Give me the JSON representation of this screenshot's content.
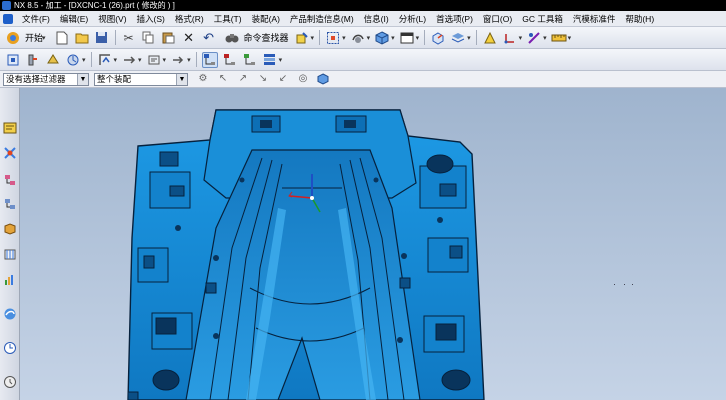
{
  "window": {
    "title": "NX 8.5 - 加工 - [DXCNC-1 (26).prt  ( 修改的 ) ]"
  },
  "menu": {
    "items": [
      "文件(F)",
      "编辑(E)",
      "视图(V)",
      "插入(S)",
      "格式(R)",
      "工具(T)",
      "装配(A)",
      "产品制造信息(M)",
      "信息(I)",
      "分析(L)",
      "首选项(P)",
      "窗口(O)",
      "GC 工具箱",
      "汽模标准件",
      "帮助(H)"
    ]
  },
  "toolbar1": {
    "start_label": "开始",
    "command_finder_label": "命令查找器"
  },
  "selection_bar": {
    "type_filter": "没有选择过滤器",
    "scope": "整个装配"
  },
  "icons": {
    "start": "start-icon",
    "new": "new-file-icon",
    "open": "open-folder-icon",
    "save": "save-icon",
    "cut": "cut-icon",
    "copy": "copy-icon",
    "paste": "paste-icon",
    "delete": "delete-icon",
    "undo": "undo-icon",
    "command_finder": "binoculars-icon"
  },
  "colors": {
    "title_bar": "#000000",
    "menu_bar": "#e9ecf2",
    "viewport_top": "#9fb4ce",
    "viewport_bottom": "#c5d3e6",
    "model_blue": "#1a8fd8",
    "model_edge": "#06213d"
  }
}
